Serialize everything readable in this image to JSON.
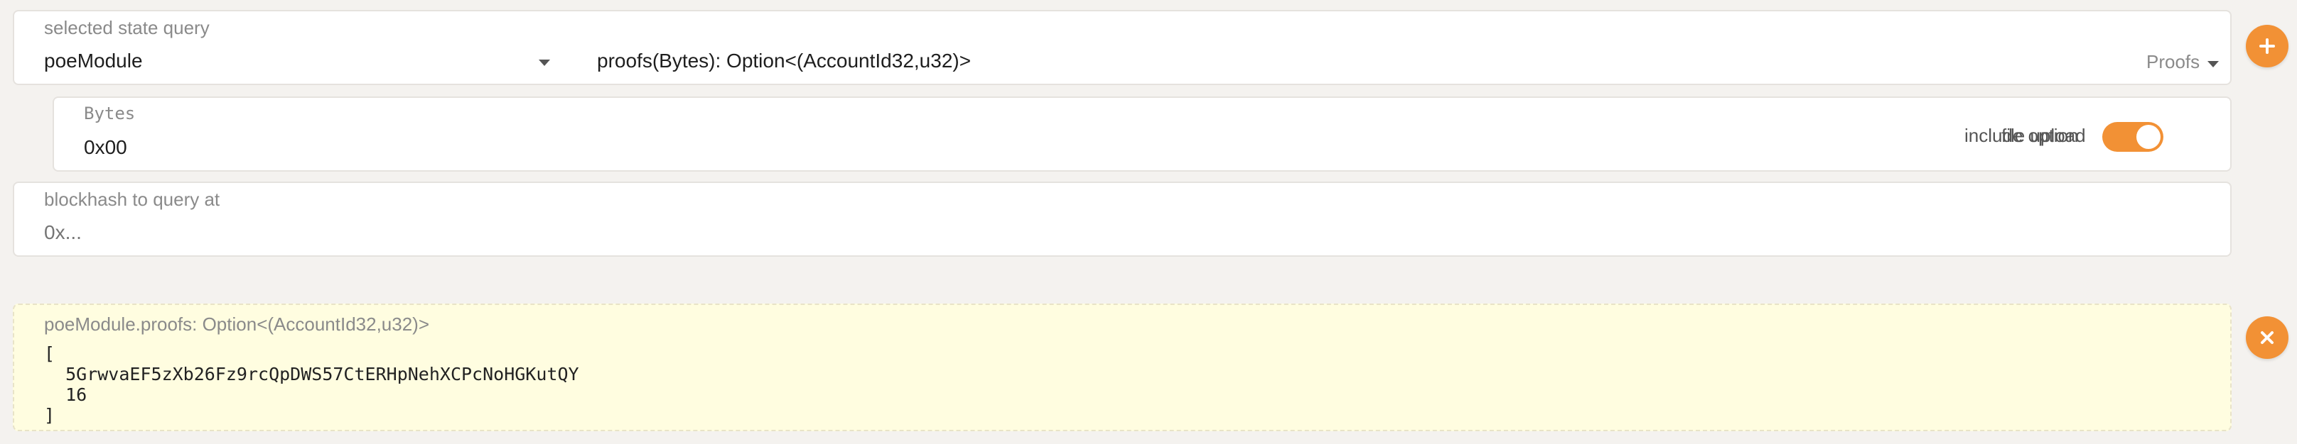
{
  "query": {
    "section_label": "selected state query",
    "module": "poeModule",
    "method": "proofs(Bytes): Option<(AccountId32,u32)>",
    "method_doc": "Proofs"
  },
  "params": {
    "bytes_label": "Bytes",
    "bytes_value": "0x00",
    "toggle_label_a": "include option",
    "toggle_label_b": "file upload",
    "toggle_on": true
  },
  "blockhash": {
    "label": "blockhash to query at",
    "placeholder": "0x..."
  },
  "result": {
    "title": "poeModule.proofs: Option<(AccountId32,u32)>",
    "output": "[\n  5GrwvaEF5zXb26Fz9rcQpDWS57CtERHpNehXCPcNoHGKutQY\n  16\n]"
  },
  "icons": {
    "add": "plus-icon",
    "close": "close-icon",
    "dropdown": "chevron-down-icon"
  },
  "colors": {
    "accent": "#f29135",
    "result_bg": "#fffde0"
  }
}
